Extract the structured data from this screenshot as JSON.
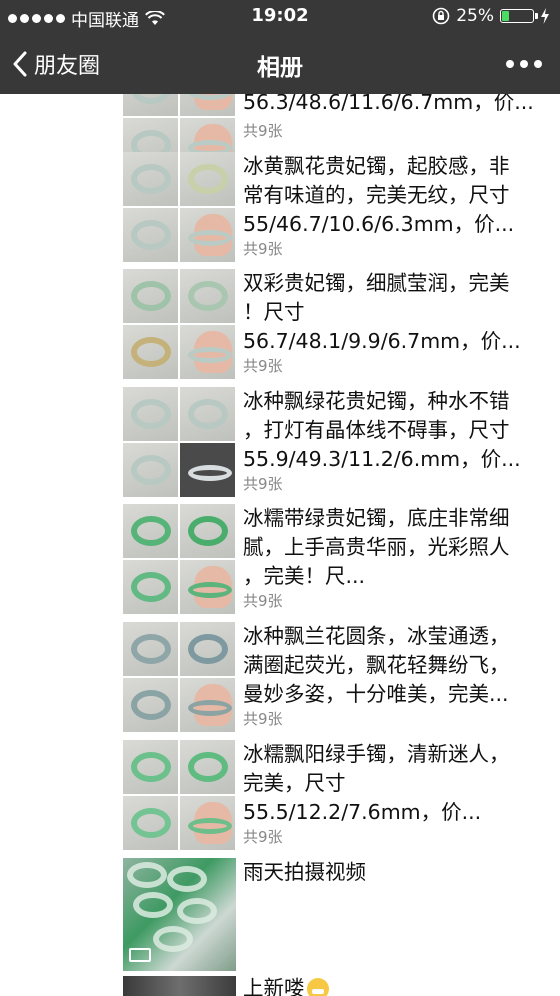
{
  "status_bar": {
    "carrier": "中国联通",
    "time": "19:02",
    "battery": "25%",
    "battery_level": 0.25
  },
  "nav": {
    "back_label": "朋友圈",
    "title": "相册"
  },
  "entries": [
    {
      "lines": [
        "56.3/48.6/11.6/6.7mm，价..."
      ],
      "count": "共9张"
    },
    {
      "lines": [
        "冰黄飘花贵妃镯，起胶感，非",
        "常有味道的，完美无纹，尺寸",
        "55/46.7/10.6/6.3mm，价..."
      ],
      "count": "共9张"
    },
    {
      "lines": [
        "双彩贵妃镯，细腻莹润，完美",
        "！尺寸",
        "56.7/48.1/9.9/6.7mm，价..."
      ],
      "count": "共9张"
    },
    {
      "lines": [
        "冰种飘绿花贵妃镯，种水不错",
        "，打灯有晶体线不碍事，尺寸",
        "55.9/49.3/11.2/6.mm，价..."
      ],
      "count": "共9张"
    },
    {
      "lines": [
        "冰糯带绿贵妃镯，底庄非常细",
        "腻，上手高贵华丽，光彩照人",
        "，完美！尺..."
      ],
      "count": "共9张"
    },
    {
      "lines": [
        "冰种飘兰花圆条，冰莹通透，",
        "满圈起荧光，飘花轻舞纷飞，",
        "曼妙多姿，十分唯美，完美..."
      ],
      "count": "共9张"
    },
    {
      "lines": [
        "冰糯飘阳绿手镯，清新迷人，",
        "完美，尺寸",
        "55.5/12.2/7.6mm，价..."
      ],
      "count": "共9张"
    }
  ],
  "video": {
    "title": "雨天拍摄视频"
  },
  "next": {
    "title": "上新喽"
  }
}
